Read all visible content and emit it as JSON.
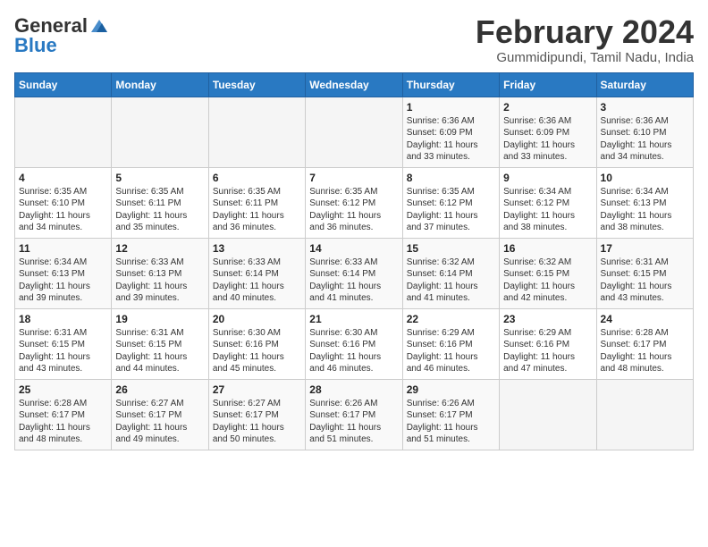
{
  "logo": {
    "general": "General",
    "blue": "Blue"
  },
  "title": "February 2024",
  "subtitle": "Gummidipundi, Tamil Nadu, India",
  "weekdays": [
    "Sunday",
    "Monday",
    "Tuesday",
    "Wednesday",
    "Thursday",
    "Friday",
    "Saturday"
  ],
  "weeks": [
    [
      {
        "day": "",
        "info": ""
      },
      {
        "day": "",
        "info": ""
      },
      {
        "day": "",
        "info": ""
      },
      {
        "day": "",
        "info": ""
      },
      {
        "day": "1",
        "info": "Sunrise: 6:36 AM\nSunset: 6:09 PM\nDaylight: 11 hours\nand 33 minutes."
      },
      {
        "day": "2",
        "info": "Sunrise: 6:36 AM\nSunset: 6:09 PM\nDaylight: 11 hours\nand 33 minutes."
      },
      {
        "day": "3",
        "info": "Sunrise: 6:36 AM\nSunset: 6:10 PM\nDaylight: 11 hours\nand 34 minutes."
      }
    ],
    [
      {
        "day": "4",
        "info": "Sunrise: 6:35 AM\nSunset: 6:10 PM\nDaylight: 11 hours\nand 34 minutes."
      },
      {
        "day": "5",
        "info": "Sunrise: 6:35 AM\nSunset: 6:11 PM\nDaylight: 11 hours\nand 35 minutes."
      },
      {
        "day": "6",
        "info": "Sunrise: 6:35 AM\nSunset: 6:11 PM\nDaylight: 11 hours\nand 36 minutes."
      },
      {
        "day": "7",
        "info": "Sunrise: 6:35 AM\nSunset: 6:12 PM\nDaylight: 11 hours\nand 36 minutes."
      },
      {
        "day": "8",
        "info": "Sunrise: 6:35 AM\nSunset: 6:12 PM\nDaylight: 11 hours\nand 37 minutes."
      },
      {
        "day": "9",
        "info": "Sunrise: 6:34 AM\nSunset: 6:12 PM\nDaylight: 11 hours\nand 38 minutes."
      },
      {
        "day": "10",
        "info": "Sunrise: 6:34 AM\nSunset: 6:13 PM\nDaylight: 11 hours\nand 38 minutes."
      }
    ],
    [
      {
        "day": "11",
        "info": "Sunrise: 6:34 AM\nSunset: 6:13 PM\nDaylight: 11 hours\nand 39 minutes."
      },
      {
        "day": "12",
        "info": "Sunrise: 6:33 AM\nSunset: 6:13 PM\nDaylight: 11 hours\nand 39 minutes."
      },
      {
        "day": "13",
        "info": "Sunrise: 6:33 AM\nSunset: 6:14 PM\nDaylight: 11 hours\nand 40 minutes."
      },
      {
        "day": "14",
        "info": "Sunrise: 6:33 AM\nSunset: 6:14 PM\nDaylight: 11 hours\nand 41 minutes."
      },
      {
        "day": "15",
        "info": "Sunrise: 6:32 AM\nSunset: 6:14 PM\nDaylight: 11 hours\nand 41 minutes."
      },
      {
        "day": "16",
        "info": "Sunrise: 6:32 AM\nSunset: 6:15 PM\nDaylight: 11 hours\nand 42 minutes."
      },
      {
        "day": "17",
        "info": "Sunrise: 6:31 AM\nSunset: 6:15 PM\nDaylight: 11 hours\nand 43 minutes."
      }
    ],
    [
      {
        "day": "18",
        "info": "Sunrise: 6:31 AM\nSunset: 6:15 PM\nDaylight: 11 hours\nand 43 minutes."
      },
      {
        "day": "19",
        "info": "Sunrise: 6:31 AM\nSunset: 6:15 PM\nDaylight: 11 hours\nand 44 minutes."
      },
      {
        "day": "20",
        "info": "Sunrise: 6:30 AM\nSunset: 6:16 PM\nDaylight: 11 hours\nand 45 minutes."
      },
      {
        "day": "21",
        "info": "Sunrise: 6:30 AM\nSunset: 6:16 PM\nDaylight: 11 hours\nand 46 minutes."
      },
      {
        "day": "22",
        "info": "Sunrise: 6:29 AM\nSunset: 6:16 PM\nDaylight: 11 hours\nand 46 minutes."
      },
      {
        "day": "23",
        "info": "Sunrise: 6:29 AM\nSunset: 6:16 PM\nDaylight: 11 hours\nand 47 minutes."
      },
      {
        "day": "24",
        "info": "Sunrise: 6:28 AM\nSunset: 6:17 PM\nDaylight: 11 hours\nand 48 minutes."
      }
    ],
    [
      {
        "day": "25",
        "info": "Sunrise: 6:28 AM\nSunset: 6:17 PM\nDaylight: 11 hours\nand 48 minutes."
      },
      {
        "day": "26",
        "info": "Sunrise: 6:27 AM\nSunset: 6:17 PM\nDaylight: 11 hours\nand 49 minutes."
      },
      {
        "day": "27",
        "info": "Sunrise: 6:27 AM\nSunset: 6:17 PM\nDaylight: 11 hours\nand 50 minutes."
      },
      {
        "day": "28",
        "info": "Sunrise: 6:26 AM\nSunset: 6:17 PM\nDaylight: 11 hours\nand 51 minutes."
      },
      {
        "day": "29",
        "info": "Sunrise: 6:26 AM\nSunset: 6:17 PM\nDaylight: 11 hours\nand 51 minutes."
      },
      {
        "day": "",
        "info": ""
      },
      {
        "day": "",
        "info": ""
      }
    ]
  ]
}
